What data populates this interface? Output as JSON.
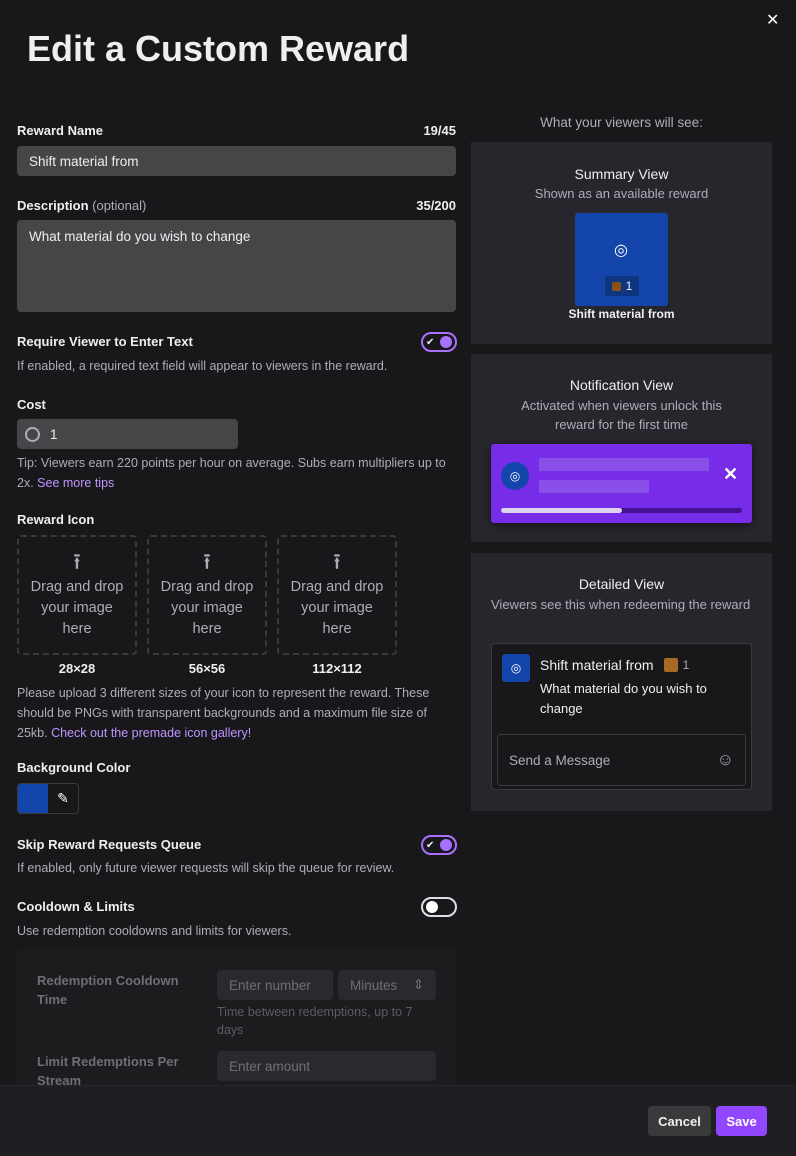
{
  "title": "Edit a Custom Reward",
  "reward_name": {
    "label": "Reward Name",
    "count": "19/45",
    "value": "Shift material from"
  },
  "description": {
    "label": "Description",
    "optional": "(optional)",
    "count": "35/200",
    "value": "What material do you wish to change"
  },
  "require_text": {
    "label": "Require Viewer to Enter Text",
    "help": "If enabled, a required text field will appear to viewers in the reward.",
    "enabled": true
  },
  "cost": {
    "label": "Cost",
    "value": "1",
    "tip": "Tip: Viewers earn 220 points per hour on average. Subs earn multipliers up to 2x.",
    "tip_link": "See more tips"
  },
  "reward_icon": {
    "label": "Reward Icon",
    "drop_text": "Drag and drop your image here",
    "sizes": [
      "28×28",
      "56×56",
      "112×112"
    ],
    "help": "Please upload 3 different sizes of your icon to represent the reward. These should be PNGs with transparent backgrounds and a maximum file size of 25kb.",
    "help_link": "Check out the premade icon gallery!"
  },
  "background_color": {
    "label": "Background Color",
    "value": "#1345aa"
  },
  "skip_queue": {
    "label": "Skip Reward Requests Queue",
    "help": "If enabled, only future viewer requests will skip the queue for review.",
    "enabled": true
  },
  "cooldown": {
    "label": "Cooldown & Limits",
    "help": "Use redemption cooldowns and limits for viewers.",
    "enabled": false,
    "cooldown_label": "Redemption Cooldown Time",
    "cooldown_placeholder": "Enter number",
    "unit": "Minutes",
    "cooldown_help": "Time between redemptions, up to 7 days",
    "limit_label": "Limit Redemptions Per Stream",
    "limit_placeholder": "Enter amount"
  },
  "preview": {
    "heading": "What your viewers will see:",
    "summary": {
      "title": "Summary View",
      "subtitle": "Shown as an available reward",
      "cost": "1",
      "name": "Shift material from"
    },
    "notification": {
      "title": "Notification View",
      "subtitle": "Activated when viewers unlock this reward for the first time",
      "progress": 0.5
    },
    "detailed": {
      "title": "Detailed View",
      "subtitle": "Viewers see this when redeeming the reward",
      "name": "Shift material from",
      "cost": "1",
      "prompt": "What material do you wish to change",
      "message_placeholder": "Send a Message"
    }
  },
  "footer": {
    "cancel": "Cancel",
    "save": "Save"
  },
  "colors": {
    "accent": "#9147ff",
    "notification_bg": "#772ce8",
    "reward_bg": "#1345aa"
  }
}
